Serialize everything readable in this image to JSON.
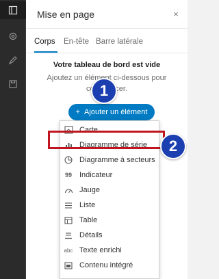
{
  "rail": {
    "icons": [
      "layout-icon",
      "gear-icon",
      "brush-icon",
      "save-icon"
    ]
  },
  "panel": {
    "title": "Mise en page",
    "close_glyph": "×",
    "tabs": [
      {
        "label": "Corps"
      },
      {
        "label": "En-tête"
      },
      {
        "label": "Barre latérale"
      }
    ],
    "empty_title": "Votre tableau de bord est vide",
    "empty_desc": "Ajoutez un élément ci-dessous pour commencer.",
    "add_button": "Ajouter un élément",
    "add_glyph": "+"
  },
  "menu": {
    "items": [
      {
        "label": "Carte",
        "icon": "map-icon"
      },
      {
        "label": "Diagramme de série",
        "icon": "bar-chart-icon"
      },
      {
        "label": "Diagramme à secteurs",
        "icon": "pie-chart-icon"
      },
      {
        "label": "Indicateur",
        "icon": "indicator-icon"
      },
      {
        "label": "Jauge",
        "icon": "gauge-icon"
      },
      {
        "label": "Liste",
        "icon": "list-icon"
      },
      {
        "label": "Table",
        "icon": "table-icon"
      },
      {
        "label": "Détails",
        "icon": "details-icon"
      },
      {
        "label": "Texte enrichi",
        "icon": "rich-text-icon"
      },
      {
        "label": "Contenu intégré",
        "icon": "embed-icon"
      }
    ]
  },
  "callouts": [
    "1",
    "2"
  ],
  "colors": {
    "accent": "#007ac2",
    "highlight": "#c0151e",
    "callout": "#1b3fb0",
    "rail": "#2b2b2b"
  }
}
